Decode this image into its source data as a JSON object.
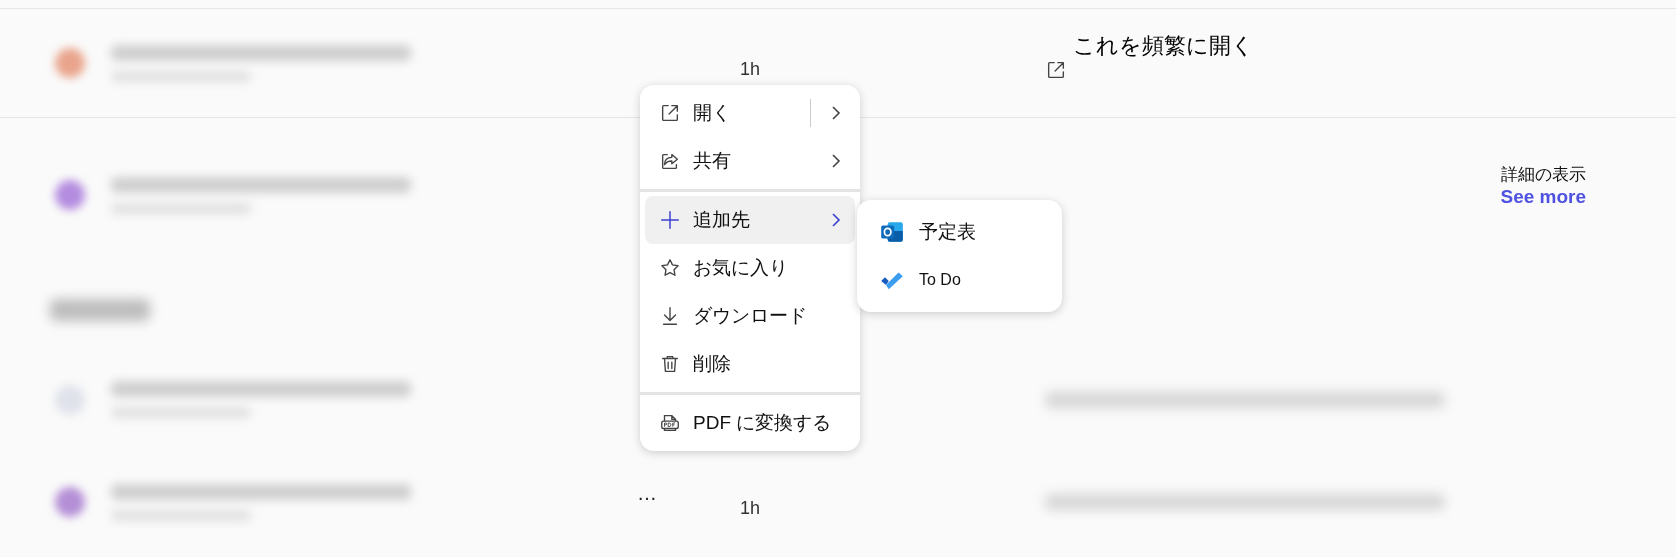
{
  "rows": [
    {
      "kind": "file",
      "color": "#e9a48c",
      "time": "1h",
      "reason": "これを頻繁に開く"
    },
    {
      "kind": "file",
      "color": "#b48ce0",
      "link": {
        "caption": "詳細の表示",
        "label": "See more"
      }
    },
    {
      "kind": "heading"
    },
    {
      "kind": "file",
      "color": "#dfe2ea"
    },
    {
      "kind": "file",
      "color": "#b48ed6",
      "time": "1h",
      "ellipsis_text": "…"
    }
  ],
  "context_menu": {
    "items": [
      {
        "kind": "open",
        "label": "開く",
        "submenu": true,
        "split": true,
        "selected": false
      },
      {
        "kind": "share",
        "label": "共有",
        "submenu": true,
        "split": false,
        "selected": false
      },
      {
        "kind": "divider"
      },
      {
        "kind": "add",
        "label": "追加先",
        "submenu": true,
        "split": false,
        "selected": true
      },
      {
        "kind": "favorite",
        "label": "お気に入り",
        "submenu": false,
        "split": false,
        "selected": false
      },
      {
        "kind": "download",
        "label": "ダウンロード",
        "submenu": false,
        "split": false,
        "selected": false
      },
      {
        "kind": "delete",
        "label": "削除",
        "submenu": false,
        "split": false,
        "selected": false
      },
      {
        "kind": "divider"
      },
      {
        "kind": "pdf",
        "label": "PDF に変換する",
        "submenu": false,
        "split": false,
        "selected": false
      }
    ]
  },
  "submenu": {
    "items": [
      {
        "kind": "calendar",
        "label": "予定表"
      },
      {
        "kind": "todo",
        "label": "To Do"
      }
    ]
  }
}
